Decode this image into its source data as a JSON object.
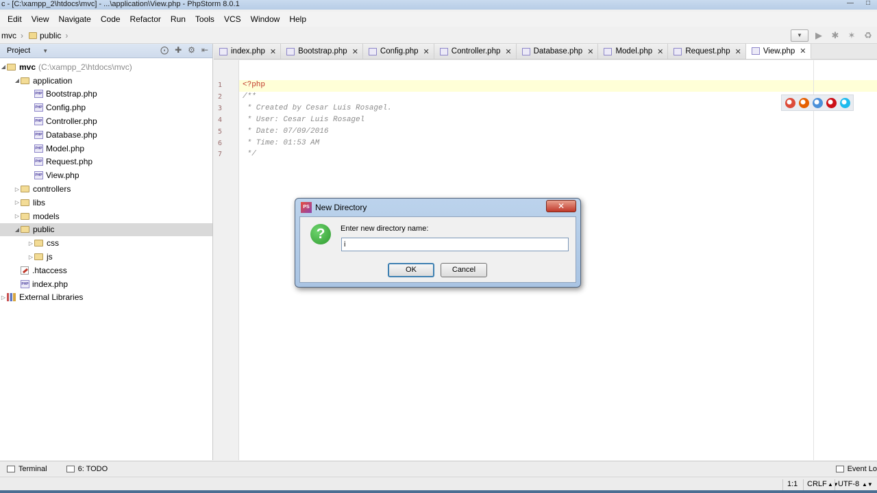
{
  "window": {
    "title": "c - [C:\\xampp_2\\htdocs\\mvc] - ...\\application\\View.php - PhpStorm 8.0.1"
  },
  "menu": [
    "Edit",
    "View",
    "Navigate",
    "Code",
    "Refactor",
    "Run",
    "Tools",
    "VCS",
    "Window",
    "Help"
  ],
  "breadcrumb": {
    "project": "mvc",
    "folder": "public"
  },
  "project_panel": {
    "title": "Project",
    "tree": [
      {
        "label": "mvc",
        "path": "(C:\\xampp_2\\htdocs\\mvc)",
        "type": "folder",
        "level": 0,
        "expanded": true,
        "bold": true
      },
      {
        "label": "application",
        "type": "folder",
        "level": 1,
        "expanded": true
      },
      {
        "label": "Bootstrap.php",
        "type": "php",
        "level": 2
      },
      {
        "label": "Config.php",
        "type": "php",
        "level": 2
      },
      {
        "label": "Controller.php",
        "type": "php",
        "level": 2
      },
      {
        "label": "Database.php",
        "type": "php",
        "level": 2
      },
      {
        "label": "Model.php",
        "type": "php",
        "level": 2
      },
      {
        "label": "Request.php",
        "type": "php",
        "level": 2
      },
      {
        "label": "View.php",
        "type": "php",
        "level": 2
      },
      {
        "label": "controllers",
        "type": "folder",
        "level": 1,
        "expanded": false
      },
      {
        "label": "libs",
        "type": "folder",
        "level": 1,
        "expanded": false
      },
      {
        "label": "models",
        "type": "folder",
        "level": 1,
        "expanded": false
      },
      {
        "label": "public",
        "type": "folder",
        "level": 1,
        "expanded": true,
        "selected": true
      },
      {
        "label": "css",
        "type": "folder",
        "level": 2
      },
      {
        "label": "js",
        "type": "folder",
        "level": 2
      },
      {
        "label": ".htaccess",
        "type": "htaccess",
        "level": 1
      },
      {
        "label": "index.php",
        "type": "php",
        "level": 1
      },
      {
        "label": "External Libraries",
        "type": "lib",
        "level": 0,
        "expanded": false
      }
    ]
  },
  "editor": {
    "tabs": [
      {
        "label": "index.php",
        "active": false
      },
      {
        "label": "Bootstrap.php",
        "active": false
      },
      {
        "label": "Config.php",
        "active": false
      },
      {
        "label": "Controller.php",
        "active": false
      },
      {
        "label": "Database.php",
        "active": false
      },
      {
        "label": "Model.php",
        "active": false
      },
      {
        "label": "Request.php",
        "active": false
      },
      {
        "label": "View.php",
        "active": true
      }
    ],
    "lines": [
      {
        "n": "1",
        "text": "<?php",
        "kind": "tag"
      },
      {
        "n": "2",
        "text": "/**",
        "kind": "cmt"
      },
      {
        "n": "3",
        "text": " * Created by Cesar Luis Rosagel.",
        "kind": "cmt"
      },
      {
        "n": "4",
        "text": " * User: Cesar Luis Rosagel",
        "kind": "cmt"
      },
      {
        "n": "5",
        "text": " * Date: 07/09/2016",
        "kind": "cmt"
      },
      {
        "n": "6",
        "text": " * Time: 01:53 AM",
        "kind": "cmt"
      },
      {
        "n": "7",
        "text": " */",
        "kind": "cmt"
      }
    ],
    "browser_icons": [
      {
        "name": "chrome-icon",
        "color": "#dd4b39"
      },
      {
        "name": "firefox-icon",
        "color": "#e66000"
      },
      {
        "name": "safari-icon",
        "color": "#4a90d9"
      },
      {
        "name": "opera-icon",
        "color": "#cc0f16"
      },
      {
        "name": "ie-icon",
        "color": "#1ebbee"
      }
    ]
  },
  "dialog": {
    "title": "New Directory",
    "prompt": "Enter new directory name:",
    "input_value": "i",
    "ok_label": "OK",
    "cancel_label": "Cancel"
  },
  "tool_windows": {
    "terminal": "Terminal",
    "todo": "6: TODO",
    "event_log": "Event Lo"
  },
  "status": {
    "position": "1:1",
    "line_sep": "CRLF",
    "encoding": "UTF-8"
  }
}
